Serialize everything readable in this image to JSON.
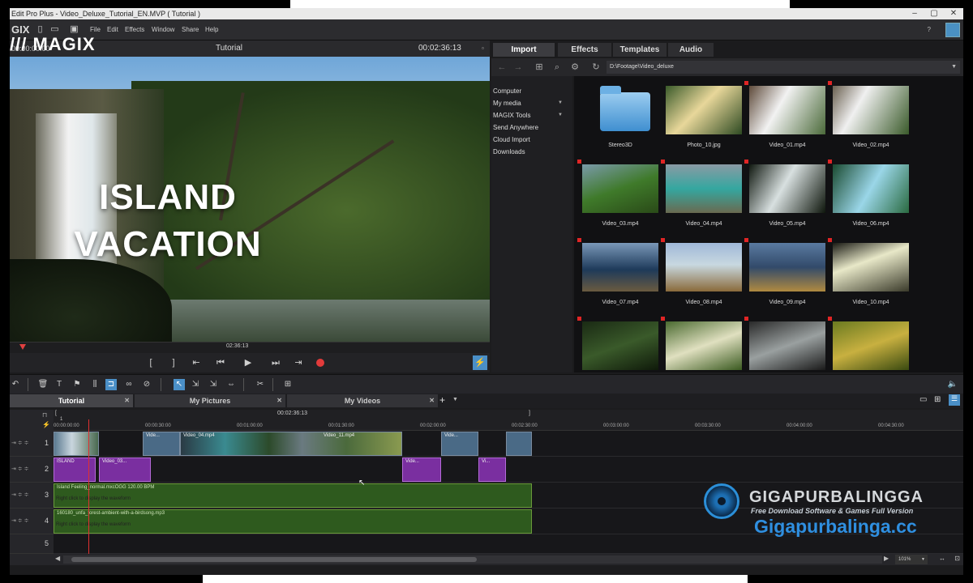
{
  "window": {
    "title": "Edit Pro Plus - Video_Deluxe_Tutorial_EN.MVP ( Tutorial )",
    "controls": [
      "–",
      "▢",
      "✕"
    ]
  },
  "menubar": {
    "logo": "GIX",
    "items": [
      "File",
      "Edit",
      "Effects",
      "Window",
      "Share",
      "Help"
    ],
    "help": "?"
  },
  "brand": "/// MAGIX",
  "preview": {
    "time_left": "00:00:00:00",
    "title": "Tutorial",
    "time_right": "00:02:36:13",
    "headline_1": "ISLAND",
    "headline_2": "VACATION",
    "scrub_time": "02:36:13"
  },
  "transport": {
    "buttons": [
      "[",
      "]",
      "⇤",
      "⏮",
      "▶",
      "⏭",
      "⇥"
    ]
  },
  "media_pool": {
    "tabs": [
      "Import",
      "Effects",
      "Templates",
      "Audio"
    ],
    "active_tab": "Import",
    "path": "D:\\Footage\\Video_deluxe",
    "tree": [
      "Computer",
      "My media",
      "MAGIX Tools",
      "Send Anywhere",
      "Cloud Import",
      "Downloads"
    ],
    "files": [
      {
        "name": "Stereo3D",
        "kind": "folder",
        "flag": false
      },
      {
        "name": "Photo_10.jpg",
        "kind": "photo",
        "flag": false
      },
      {
        "name": "Video_01.mp4",
        "kind": "video",
        "flag": true
      },
      {
        "name": "Video_02.mp4",
        "kind": "video",
        "flag": true
      },
      {
        "name": "Video_03.mp4",
        "kind": "video",
        "flag": true
      },
      {
        "name": "Video_04.mp4",
        "kind": "video",
        "flag": true
      },
      {
        "name": "Video_05.mp4",
        "kind": "video",
        "flag": true
      },
      {
        "name": "Video_06.mp4",
        "kind": "video",
        "flag": true
      },
      {
        "name": "Video_07.mp4",
        "kind": "video",
        "flag": true
      },
      {
        "name": "Video_08.mp4",
        "kind": "video",
        "flag": true
      },
      {
        "name": "Video_09.mp4",
        "kind": "video",
        "flag": true
      },
      {
        "name": "Video_10.mp4",
        "kind": "video",
        "flag": true
      },
      {
        "name": "",
        "kind": "video",
        "flag": true
      },
      {
        "name": "",
        "kind": "video",
        "flag": true
      },
      {
        "name": "",
        "kind": "video",
        "flag": true
      },
      {
        "name": "",
        "kind": "video",
        "flag": true
      }
    ]
  },
  "project_tabs": [
    "Tutorial",
    "My Pictures",
    "My Videos"
  ],
  "timeline": {
    "ruler_time": "00:02:36:13",
    "ticks": [
      "00:00:00:00",
      "00:00:30:00",
      "00:01:00:00",
      "00:01:30:00",
      "00:02:00:00",
      "00:02:30:00",
      "00:03:00:00",
      "00:03:30:00",
      "00:04:00:00",
      "00:04:30:00"
    ],
    "tracks": [
      "1",
      "2",
      "3",
      "4",
      "5"
    ],
    "clips": {
      "t1_label_1": "Vide...",
      "t1_label_2": "Video_04.mp4",
      "t1_label_3": "Video_11.mp4",
      "t1_label_4": "Vide...",
      "t2_label_1": "ISLAND",
      "t2_label_2": "Video_03...",
      "t2_label_3": "Vide...",
      "t2_label_4": "Vi...",
      "t3_label": "Island Feeling_normal.mxcOGG  120.00 BPM",
      "t3_hint": "Right click to display the waveform",
      "t4_label": "160180_unfa_forest-ambient-with-a-birdsong.mp3",
      "t4_hint": "Right click to display the waveform"
    },
    "zoom": "101%"
  },
  "watermark": {
    "title": "GIGAPURBALINGGA",
    "subtitle": "Free Download Software & Games Full Version",
    "url": "Gigapurbalinga.cc"
  }
}
